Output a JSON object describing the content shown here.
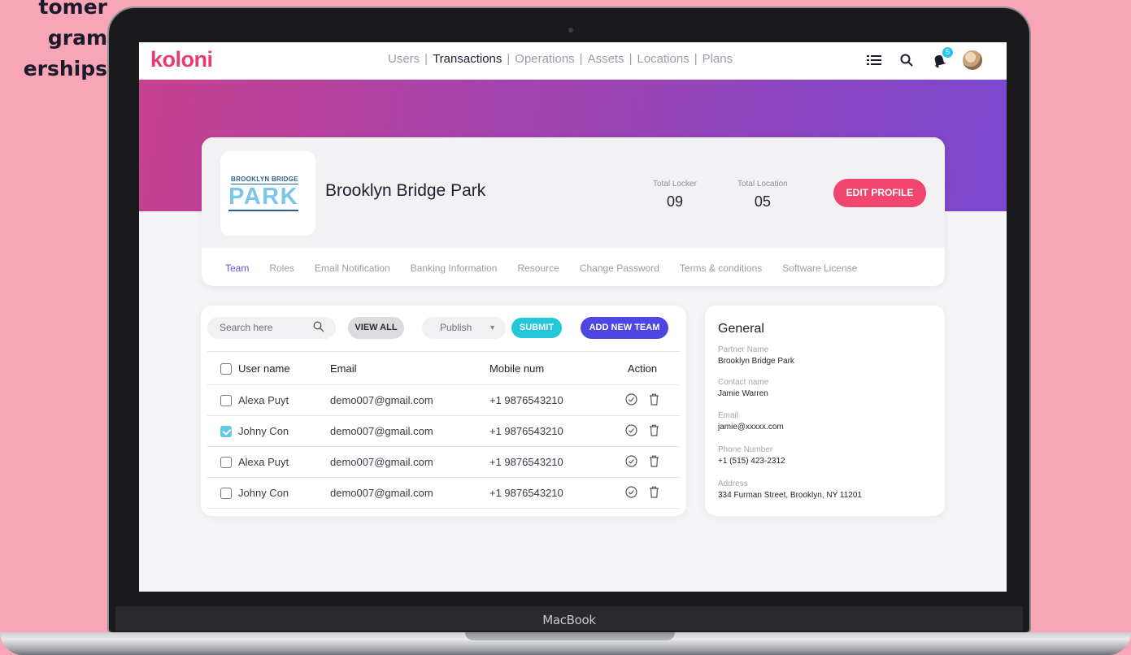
{
  "side_text": [
    "tomer",
    "gram",
    "erships"
  ],
  "device_label": "MacBook",
  "app": {
    "logo": "koloni",
    "nav": [
      {
        "label": "Users",
        "active": false
      },
      {
        "label": "Transactions",
        "active": true
      },
      {
        "label": "Operations",
        "active": false
      },
      {
        "label": "Assets",
        "active": false
      },
      {
        "label": "Locations",
        "active": false
      },
      {
        "label": "Plans",
        "active": false
      }
    ],
    "notification_count": "5",
    "icons": [
      "list-icon",
      "search-icon",
      "bell-icon",
      "avatar"
    ]
  },
  "profile": {
    "logo_small": "BROOKLYN BRIDGE",
    "logo_big": "PARK",
    "name": "Brooklyn Bridge Park",
    "stats": [
      {
        "label": "Total Locker",
        "value": "09"
      },
      {
        "label": "Total Location",
        "value": "05"
      }
    ],
    "edit_button": "EDIT PROFILE",
    "tabs": [
      {
        "label": "Team",
        "active": true
      },
      {
        "label": "Roles",
        "active": false
      },
      {
        "label": "Email Notification",
        "active": false
      },
      {
        "label": "Banking Information",
        "active": false
      },
      {
        "label": "Resource",
        "active": false
      },
      {
        "label": "Change Password",
        "active": false
      },
      {
        "label": "Terms & conditions",
        "active": false
      },
      {
        "label": "Software License",
        "active": false
      }
    ]
  },
  "team": {
    "search_placeholder": "Search here",
    "view_all": "VIEW ALL",
    "publish_value": "Publish",
    "submit": "SUBMIT",
    "add_new": "ADD NEW TEAM",
    "columns": [
      "User name",
      "Email",
      "Mobile num",
      "Action"
    ],
    "rows": [
      {
        "checked": false,
        "name": "Alexa Puyt",
        "email": "demo007@gmail.com",
        "mobile": "+1 9876543210"
      },
      {
        "checked": true,
        "name": "Johny Con",
        "email": "demo007@gmail.com",
        "mobile": "+1 9876543210"
      },
      {
        "checked": false,
        "name": "Alexa Puyt",
        "email": "demo007@gmail.com",
        "mobile": "+1 9876543210"
      },
      {
        "checked": false,
        "name": "Johny Con",
        "email": "demo007@gmail.com",
        "mobile": "+1 9876543210"
      }
    ]
  },
  "general": {
    "title": "General",
    "fields": [
      {
        "label": "Partner Name",
        "value": "Brooklyn Bridge Park"
      },
      {
        "label": "Contact name",
        "value": "Jamie Warren"
      },
      {
        "label": "Email",
        "value": "jamie@xxxxx.com"
      },
      {
        "label": "Phone Number",
        "value": "+1 (515) 423-2312"
      },
      {
        "label": "Address",
        "value": "334 Furman Street, Brooklyn, NY 11201"
      }
    ]
  },
  "colors": {
    "brand": "#e93b6f",
    "edit_button": "#f0456d",
    "submit": "#22c8d9",
    "add_team": "#4c47e0",
    "background": "#f8a5b7"
  }
}
